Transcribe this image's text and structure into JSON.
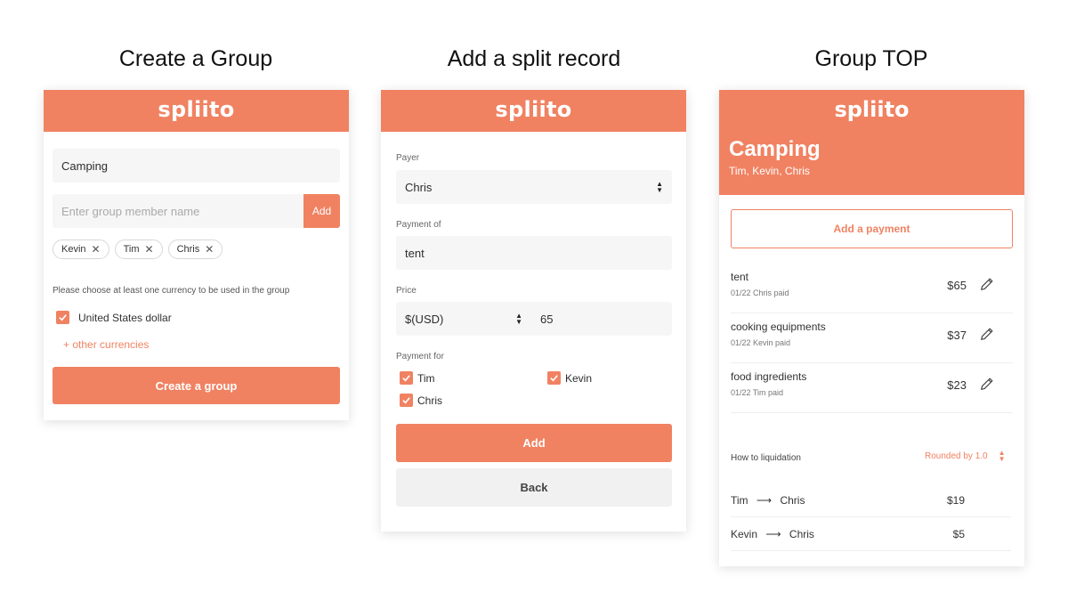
{
  "titles": {
    "create_group": "Create a Group",
    "add_split": "Add a split record",
    "group_top": "Group TOP"
  },
  "brand": "spliito",
  "colors": {
    "accent": "#f08262",
    "field_bg": "#f6f6f6"
  },
  "create": {
    "group_name_value": "Camping",
    "member_placeholder": "Enter group member name",
    "add_label": "Add",
    "members": [
      "Kevin",
      "Tim",
      "Chris"
    ],
    "currency_hint": "Please choose at least one currency to be used in the group",
    "currency_checked": "United States dollar",
    "other_currencies": "+ other currencies",
    "create_button": "Create a group"
  },
  "split": {
    "payer_label": "Payer",
    "payer_value": "Chris",
    "payment_of_label": "Payment of",
    "payment_of_value": "tent",
    "price_label": "Price",
    "currency_value": "$(USD)",
    "price_value": "65",
    "payment_for_label": "Payment for",
    "payment_for": [
      "Tim",
      "Kevin",
      "Chris"
    ],
    "add_button": "Add",
    "back_button": "Back"
  },
  "top": {
    "group_name": "Camping",
    "members_line": "Tim, Kevin, Chris",
    "add_payment": "Add a payment",
    "payments": [
      {
        "name": "tent",
        "sub": "01/22 Chris paid",
        "amount": "$65"
      },
      {
        "name": "cooking equipments",
        "sub": "01/22 Kevin paid",
        "amount": "$37"
      },
      {
        "name": "food ingredients",
        "sub": "01/22 Tim paid",
        "amount": "$23"
      }
    ],
    "liquidation_label": "How to liquidation",
    "rounding": "Rounded by 1.0",
    "settlements": [
      {
        "from": "Tim",
        "to": "Chris",
        "amount": "$19"
      },
      {
        "from": "Kevin",
        "to": "Chris",
        "amount": "$5"
      }
    ]
  },
  "icons": [
    "close-icon",
    "check-icon",
    "select-arrows-icon",
    "pencil-icon",
    "arrow-right-icon"
  ]
}
